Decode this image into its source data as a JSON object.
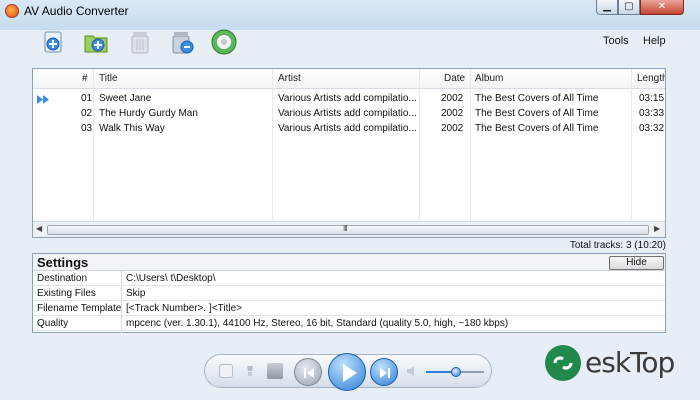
{
  "window": {
    "title": "AV Audio Converter"
  },
  "toolbar": {
    "icons": [
      "add-file-icon",
      "add-folder-icon",
      "delete-icon",
      "delete-all-icon",
      "convert-icon"
    ],
    "menu": {
      "tools": "Tools",
      "help": "Help"
    }
  },
  "table": {
    "headers": {
      "num": "#",
      "title": "Title",
      "artist": "Artist",
      "date": "Date",
      "album": "Album",
      "length": "Length"
    },
    "rows": [
      {
        "num": "01",
        "title": "Sweet Jane",
        "artist": "Various Artists add compilatio...",
        "date": "2002",
        "album": "The Best Covers of All Time",
        "length": "03:15",
        "playing": true
      },
      {
        "num": "02",
        "title": "The Hurdy Gurdy Man",
        "artist": "Various Artists add compilatio...",
        "date": "2002",
        "album": "The Best Covers of All Time",
        "length": "03:33",
        "playing": false
      },
      {
        "num": "03",
        "title": "Walk This Way",
        "artist": "Various Artists add compilatio...",
        "date": "2002",
        "album": "The Best Covers of All Time",
        "length": "03:32",
        "playing": false
      }
    ],
    "scroll_grip": "III",
    "total": "Total tracks: 3 (10:20)"
  },
  "settings": {
    "title": "Settings",
    "hide_label": "Hide",
    "rows": [
      {
        "key": "Destination",
        "value": "C:\\Users\\      t\\Desktop\\"
      },
      {
        "key": "Existing Files",
        "value": "Skip"
      },
      {
        "key": "Filename Template",
        "value": "[<Track Number>. ]<Title>"
      },
      {
        "key": "Quality",
        "value": "mpcenc (ver. 1.30.1), 44100 Hz, Stereo, 16 bit, Standard (quality 5.0, high, ~180 kbps)"
      }
    ]
  },
  "player": {
    "volume_fraction": 0.52
  },
  "watermark": {
    "text": "eskTop"
  },
  "colors": {
    "accent": "#2f7fd6",
    "watermark_green": "#1f8a4c"
  }
}
